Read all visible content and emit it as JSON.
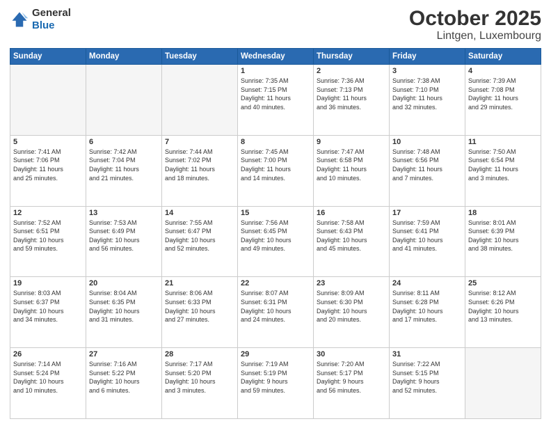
{
  "header": {
    "logo_line1": "General",
    "logo_line2": "Blue",
    "title": "October 2025",
    "subtitle": "Lintgen, Luxembourg"
  },
  "weekdays": [
    "Sunday",
    "Monday",
    "Tuesday",
    "Wednesday",
    "Thursday",
    "Friday",
    "Saturday"
  ],
  "weeks": [
    [
      {
        "day": "",
        "info": ""
      },
      {
        "day": "",
        "info": ""
      },
      {
        "day": "",
        "info": ""
      },
      {
        "day": "1",
        "info": "Sunrise: 7:35 AM\nSunset: 7:15 PM\nDaylight: 11 hours\nand 40 minutes."
      },
      {
        "day": "2",
        "info": "Sunrise: 7:36 AM\nSunset: 7:13 PM\nDaylight: 11 hours\nand 36 minutes."
      },
      {
        "day": "3",
        "info": "Sunrise: 7:38 AM\nSunset: 7:10 PM\nDaylight: 11 hours\nand 32 minutes."
      },
      {
        "day": "4",
        "info": "Sunrise: 7:39 AM\nSunset: 7:08 PM\nDaylight: 11 hours\nand 29 minutes."
      }
    ],
    [
      {
        "day": "5",
        "info": "Sunrise: 7:41 AM\nSunset: 7:06 PM\nDaylight: 11 hours\nand 25 minutes."
      },
      {
        "day": "6",
        "info": "Sunrise: 7:42 AM\nSunset: 7:04 PM\nDaylight: 11 hours\nand 21 minutes."
      },
      {
        "day": "7",
        "info": "Sunrise: 7:44 AM\nSunset: 7:02 PM\nDaylight: 11 hours\nand 18 minutes."
      },
      {
        "day": "8",
        "info": "Sunrise: 7:45 AM\nSunset: 7:00 PM\nDaylight: 11 hours\nand 14 minutes."
      },
      {
        "day": "9",
        "info": "Sunrise: 7:47 AM\nSunset: 6:58 PM\nDaylight: 11 hours\nand 10 minutes."
      },
      {
        "day": "10",
        "info": "Sunrise: 7:48 AM\nSunset: 6:56 PM\nDaylight: 11 hours\nand 7 minutes."
      },
      {
        "day": "11",
        "info": "Sunrise: 7:50 AM\nSunset: 6:54 PM\nDaylight: 11 hours\nand 3 minutes."
      }
    ],
    [
      {
        "day": "12",
        "info": "Sunrise: 7:52 AM\nSunset: 6:51 PM\nDaylight: 10 hours\nand 59 minutes."
      },
      {
        "day": "13",
        "info": "Sunrise: 7:53 AM\nSunset: 6:49 PM\nDaylight: 10 hours\nand 56 minutes."
      },
      {
        "day": "14",
        "info": "Sunrise: 7:55 AM\nSunset: 6:47 PM\nDaylight: 10 hours\nand 52 minutes."
      },
      {
        "day": "15",
        "info": "Sunrise: 7:56 AM\nSunset: 6:45 PM\nDaylight: 10 hours\nand 49 minutes."
      },
      {
        "day": "16",
        "info": "Sunrise: 7:58 AM\nSunset: 6:43 PM\nDaylight: 10 hours\nand 45 minutes."
      },
      {
        "day": "17",
        "info": "Sunrise: 7:59 AM\nSunset: 6:41 PM\nDaylight: 10 hours\nand 41 minutes."
      },
      {
        "day": "18",
        "info": "Sunrise: 8:01 AM\nSunset: 6:39 PM\nDaylight: 10 hours\nand 38 minutes."
      }
    ],
    [
      {
        "day": "19",
        "info": "Sunrise: 8:03 AM\nSunset: 6:37 PM\nDaylight: 10 hours\nand 34 minutes."
      },
      {
        "day": "20",
        "info": "Sunrise: 8:04 AM\nSunset: 6:35 PM\nDaylight: 10 hours\nand 31 minutes."
      },
      {
        "day": "21",
        "info": "Sunrise: 8:06 AM\nSunset: 6:33 PM\nDaylight: 10 hours\nand 27 minutes."
      },
      {
        "day": "22",
        "info": "Sunrise: 8:07 AM\nSunset: 6:31 PM\nDaylight: 10 hours\nand 24 minutes."
      },
      {
        "day": "23",
        "info": "Sunrise: 8:09 AM\nSunset: 6:30 PM\nDaylight: 10 hours\nand 20 minutes."
      },
      {
        "day": "24",
        "info": "Sunrise: 8:11 AM\nSunset: 6:28 PM\nDaylight: 10 hours\nand 17 minutes."
      },
      {
        "day": "25",
        "info": "Sunrise: 8:12 AM\nSunset: 6:26 PM\nDaylight: 10 hours\nand 13 minutes."
      }
    ],
    [
      {
        "day": "26",
        "info": "Sunrise: 7:14 AM\nSunset: 5:24 PM\nDaylight: 10 hours\nand 10 minutes."
      },
      {
        "day": "27",
        "info": "Sunrise: 7:16 AM\nSunset: 5:22 PM\nDaylight: 10 hours\nand 6 minutes."
      },
      {
        "day": "28",
        "info": "Sunrise: 7:17 AM\nSunset: 5:20 PM\nDaylight: 10 hours\nand 3 minutes."
      },
      {
        "day": "29",
        "info": "Sunrise: 7:19 AM\nSunset: 5:19 PM\nDaylight: 9 hours\nand 59 minutes."
      },
      {
        "day": "30",
        "info": "Sunrise: 7:20 AM\nSunset: 5:17 PM\nDaylight: 9 hours\nand 56 minutes."
      },
      {
        "day": "31",
        "info": "Sunrise: 7:22 AM\nSunset: 5:15 PM\nDaylight: 9 hours\nand 52 minutes."
      },
      {
        "day": "",
        "info": ""
      }
    ]
  ]
}
